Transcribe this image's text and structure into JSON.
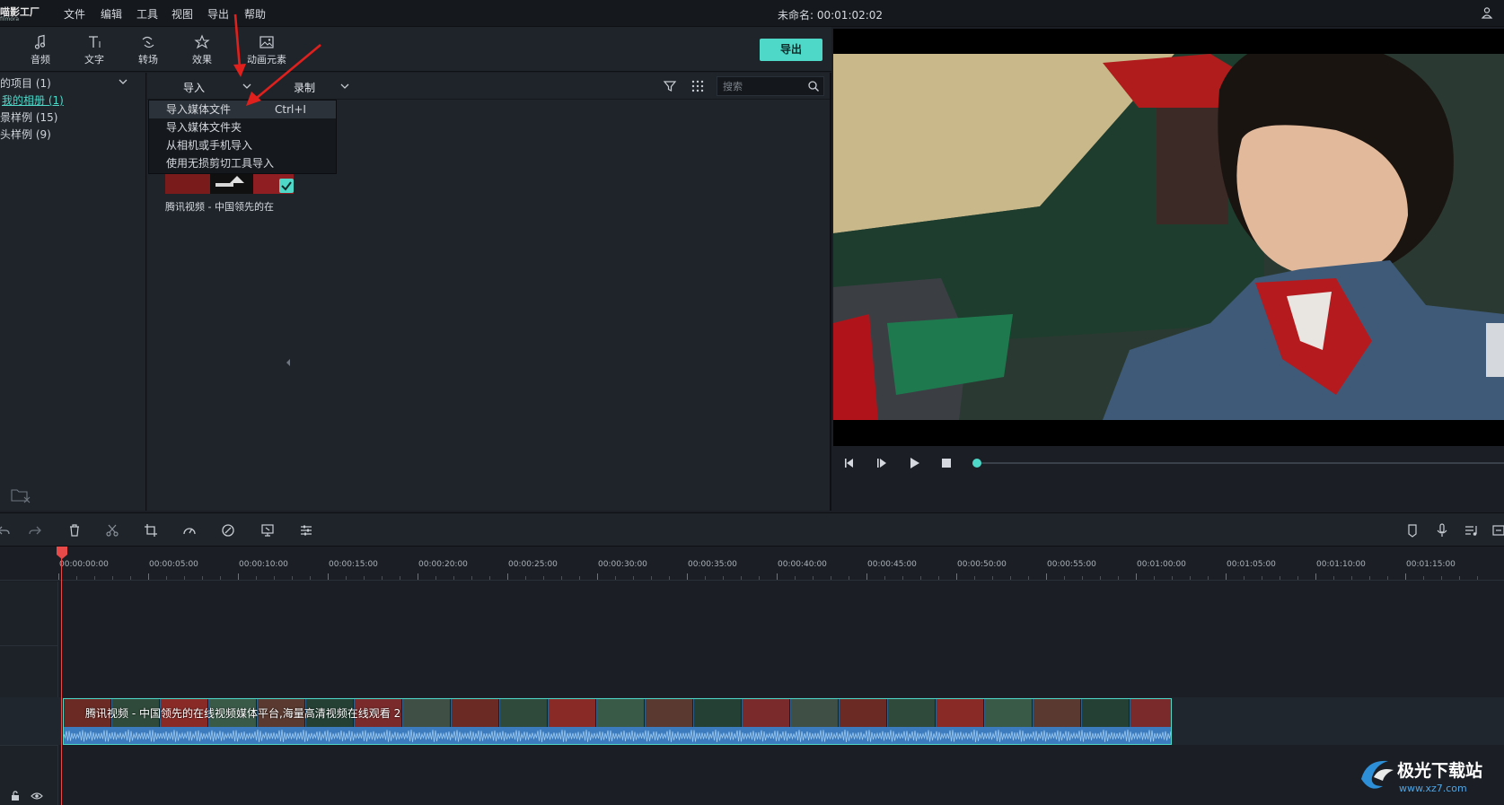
{
  "app": {
    "logo_text": "喵影工厂",
    "logo_sub": "filmora"
  },
  "menu": {
    "items": [
      "文件",
      "编辑",
      "工具",
      "视图",
      "导出",
      "帮助"
    ]
  },
  "document": {
    "title": "未命名: 00:01:02:02"
  },
  "tools": {
    "items": [
      {
        "label": "音频",
        "icon": "music-note-icon"
      },
      {
        "label": "文字",
        "icon": "text-icon"
      },
      {
        "label": "转场",
        "icon": "transition-icon"
      },
      {
        "label": "效果",
        "icon": "effects-icon"
      },
      {
        "label": "动画元素",
        "icon": "image-icon"
      }
    ]
  },
  "export_button": "导出",
  "library": {
    "items": [
      {
        "label": "的项目 (1)"
      },
      {
        "label": "我的相册 (1)",
        "active": true
      },
      {
        "label": "景样例 (15)"
      },
      {
        "label": "头样例 (9)"
      }
    ]
  },
  "media_bar": {
    "import_label": "导入",
    "record_label": "录制",
    "search_placeholder": "搜索"
  },
  "import_menu": {
    "items": [
      {
        "label": "导入媒体文件",
        "shortcut": "Ctrl+I",
        "highlighted": true
      },
      {
        "label": "导入媒体文件夹",
        "shortcut": ""
      },
      {
        "label": "从相机或手机导入",
        "shortcut": ""
      },
      {
        "label": "使用无损剪切工具导入",
        "shortcut": ""
      }
    ]
  },
  "media_clip": {
    "name": "腾讯视频 - 中国领先的在"
  },
  "player": {
    "progress_fraction": 0.0
  },
  "timeline": {
    "ruler_labels": [
      "00:00:00:00",
      "00:00:05:00",
      "00:00:10:00",
      "00:00:15:00",
      "00:00:20:00",
      "00:00:25:00",
      "00:00:30:00",
      "00:00:35:00",
      "00:00:40:00",
      "00:00:45:00",
      "00:00:50:00",
      "00:00:55:00",
      "00:01:00:00",
      "00:01:05:00",
      "00:01:10:00",
      "00:01:15:00"
    ],
    "clip_title": "腾讯视频 - 中国领先的在线视频媒体平台,海量高清视频在线观看 2"
  },
  "watermark": {
    "name": "极光下载站",
    "url": "www.xz7.com"
  },
  "colors": {
    "accent": "#4ed8c8",
    "playhead": "#e84a4a",
    "annotation_arrow": "#e0201c"
  }
}
